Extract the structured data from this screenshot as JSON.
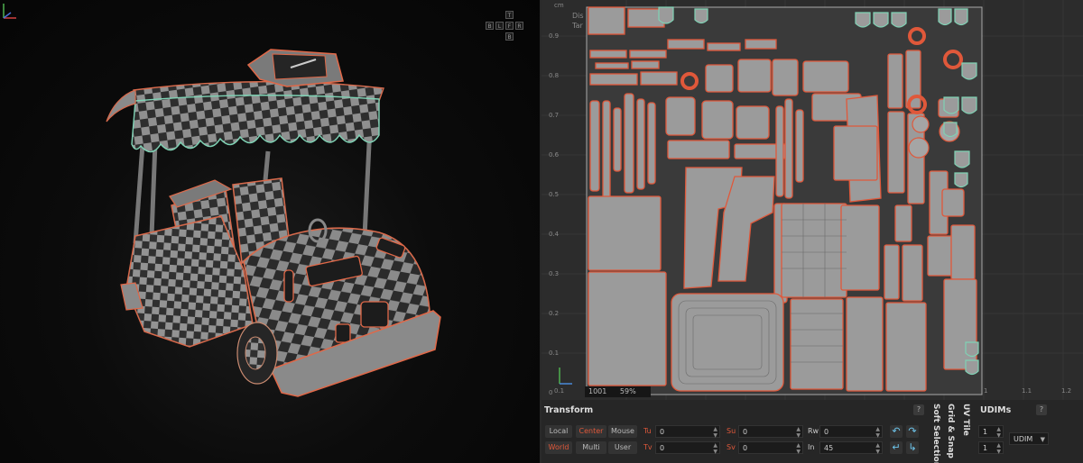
{
  "viewport3d": {
    "navcube": {
      "top": "T",
      "left": "B",
      "l2": "L",
      "front": "F",
      "right": "R",
      "bottom": "B"
    }
  },
  "uv_editor": {
    "info_line1": "Dis",
    "info_line2": "Tar",
    "unit": "cm",
    "y_ticks": [
      "0.9",
      "0.8",
      "0.7",
      "0.6",
      "0.5",
      "0.4",
      "0.3",
      "0.2",
      "0.1",
      "0"
    ],
    "x_ticks": [
      "0.1",
      "1",
      "1.1",
      "1.2"
    ],
    "status": {
      "udim": "1001",
      "zoom": "59%"
    },
    "colors": {
      "uv_border": "#e0583a",
      "shell_fill": "#9b9b9b",
      "selected_edge": "#7fd3b5"
    }
  },
  "transform": {
    "title": "Transform",
    "help": "?",
    "pivot": {
      "local": "Local",
      "center": "Center",
      "mouse": "Mouse",
      "world": "World",
      "multi": "Multi",
      "user": "User"
    },
    "tu": {
      "label": "Tu",
      "value": "0"
    },
    "tv": {
      "label": "Tv",
      "value": "0"
    },
    "su": {
      "label": "Su",
      "value": "0"
    },
    "sv": {
      "label": "Sv",
      "value": "0"
    },
    "rw": {
      "label": "Rw",
      "value": "0"
    },
    "in": {
      "label": "In",
      "value": "45"
    }
  },
  "tabs": {
    "grid_snap": "Grid & Snap",
    "soft_selection": "Soft Selection",
    "uv_tile": "UV Tile"
  },
  "udims": {
    "title": "UDIMs",
    "help": "?",
    "field1": "1",
    "field2": "1",
    "mode": "UDIM"
  }
}
